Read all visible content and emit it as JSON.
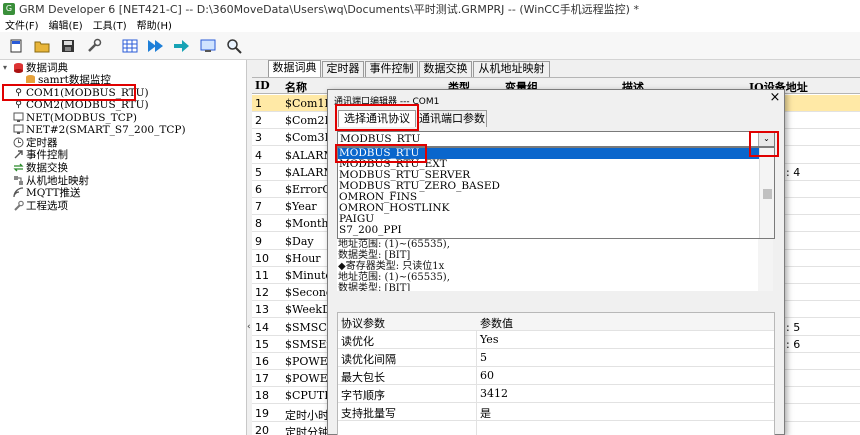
{
  "window": {
    "title": "GRM Developer 6 [NET421-C]  -- D:\\360MoveData\\Users\\wq\\Documents\\平时测试.GRMPRJ -- (WinCC手机远程监控) *"
  },
  "menu": [
    "文件(F)",
    "编辑(E)",
    "工具(T)",
    "帮助(H)"
  ],
  "toolbar_icons": [
    "new-icon",
    "open-icon",
    "save-icon",
    "tools-icon",
    "grid-icon",
    "play-icon",
    "forward-icon",
    "monitor-icon",
    "search-icon"
  ],
  "tree": {
    "items": [
      {
        "label": "数据词典",
        "icon": "db-icon"
      },
      {
        "label": "samrt数据监控",
        "icon": "db-sub-icon"
      },
      {
        "label": "COM1(MODBUS_RTU)",
        "icon": "plug-icon"
      },
      {
        "label": "COM2(MODBUS_RTU)",
        "icon": "plug-icon"
      },
      {
        "label": "NET(MODBUS_TCP)",
        "icon": "net-icon"
      },
      {
        "label": "NET#2(SMART_S7_200_TCP)",
        "icon": "net-icon"
      },
      {
        "label": "定时器",
        "icon": "clock-icon"
      },
      {
        "label": "事件控制",
        "icon": "event-icon"
      },
      {
        "label": "数据交换",
        "icon": "exchange-icon"
      },
      {
        "label": "从机地址映射",
        "icon": "map-icon"
      },
      {
        "label": "MQTT推送",
        "icon": "mqtt-icon"
      },
      {
        "label": "工程选项",
        "icon": "wrench-icon"
      }
    ]
  },
  "tabs": [
    "数据词典",
    "定时器",
    "事件控制",
    "数据交换",
    "从机地址映射"
  ],
  "grid": {
    "headers": [
      "ID",
      "名称",
      "类型",
      "变量组",
      "描述",
      "IO设备地址"
    ],
    "rows": [
      {
        "id": "1",
        "name": "$Com1Er",
        "extra": ""
      },
      {
        "id": "2",
        "name": "$Com2Er",
        "extra": ""
      },
      {
        "id": "3",
        "name": "$Com3Er",
        "extra": ""
      },
      {
        "id": "4",
        "name": "$ALARMF",
        "extra": ""
      },
      {
        "id": "5",
        "name": "$ALARMO",
        "extra": ":   4"
      },
      {
        "id": "6",
        "name": "$ErrorC",
        "extra": ""
      },
      {
        "id": "7",
        "name": "$Year",
        "extra": ""
      },
      {
        "id": "8",
        "name": "$Month",
        "extra": ""
      },
      {
        "id": "9",
        "name": "$Day",
        "extra": ""
      },
      {
        "id": "10",
        "name": "$Hour",
        "extra": ""
      },
      {
        "id": "11",
        "name": "$Minute",
        "extra": ""
      },
      {
        "id": "12",
        "name": "$Second",
        "extra": ""
      },
      {
        "id": "13",
        "name": "$WeekDa",
        "extra": ""
      },
      {
        "id": "14",
        "name": "$SMSCou",
        "extra": ":   5"
      },
      {
        "id": "15",
        "name": "$SMSErr",
        "extra": ":   6"
      },
      {
        "id": "16",
        "name": "$POWERI",
        "extra": ""
      },
      {
        "id": "17",
        "name": "$POWERI",
        "extra": ""
      },
      {
        "id": "18",
        "name": "$CPUTEM",
        "extra": ""
      },
      {
        "id": "19",
        "name": "定时小时",
        "extra": ""
      },
      {
        "id": "20",
        "name": "定时分钟",
        "extra": ""
      }
    ]
  },
  "dialog": {
    "title": "通讯端口编辑器 --- COM1",
    "close": "×",
    "tabs": [
      "选择通讯协议",
      "通讯端口参数"
    ],
    "combo_value": "MODBUS_RTU",
    "combo_arrow": "⌄",
    "protocols": [
      "MODBUS_RTU",
      "MODBUS_RTU_EXT",
      "MODBUS_RTU_SERVER",
      "MODBUS_RTU_ZERO_BASED",
      "OMRON_FINS",
      "OMRON_HOSTLINK",
      "PAIGU",
      "S7_200_PPI"
    ],
    "info_lines": [
      "地址范围: (1)~(65535),",
      "数据类型: [BIT]",
      "◆寄存器类型: 只读位1x",
      "地址范围: (1)~(65535),",
      "数据类型: [BIT]"
    ],
    "params_header": [
      "协议参数",
      "参数值"
    ],
    "params": [
      {
        "name": "读优化",
        "value": "Yes"
      },
      {
        "name": "读优化间隔",
        "value": "5"
      },
      {
        "name": "最大包长",
        "value": "60"
      },
      {
        "name": "字节顺序",
        "value": "3412"
      },
      {
        "name": "支持批量写",
        "value": "是"
      }
    ]
  },
  "colors": {
    "selection": "#0a66cc",
    "highlight_row": "#ffe9a6",
    "annotation": "#e00000"
  }
}
